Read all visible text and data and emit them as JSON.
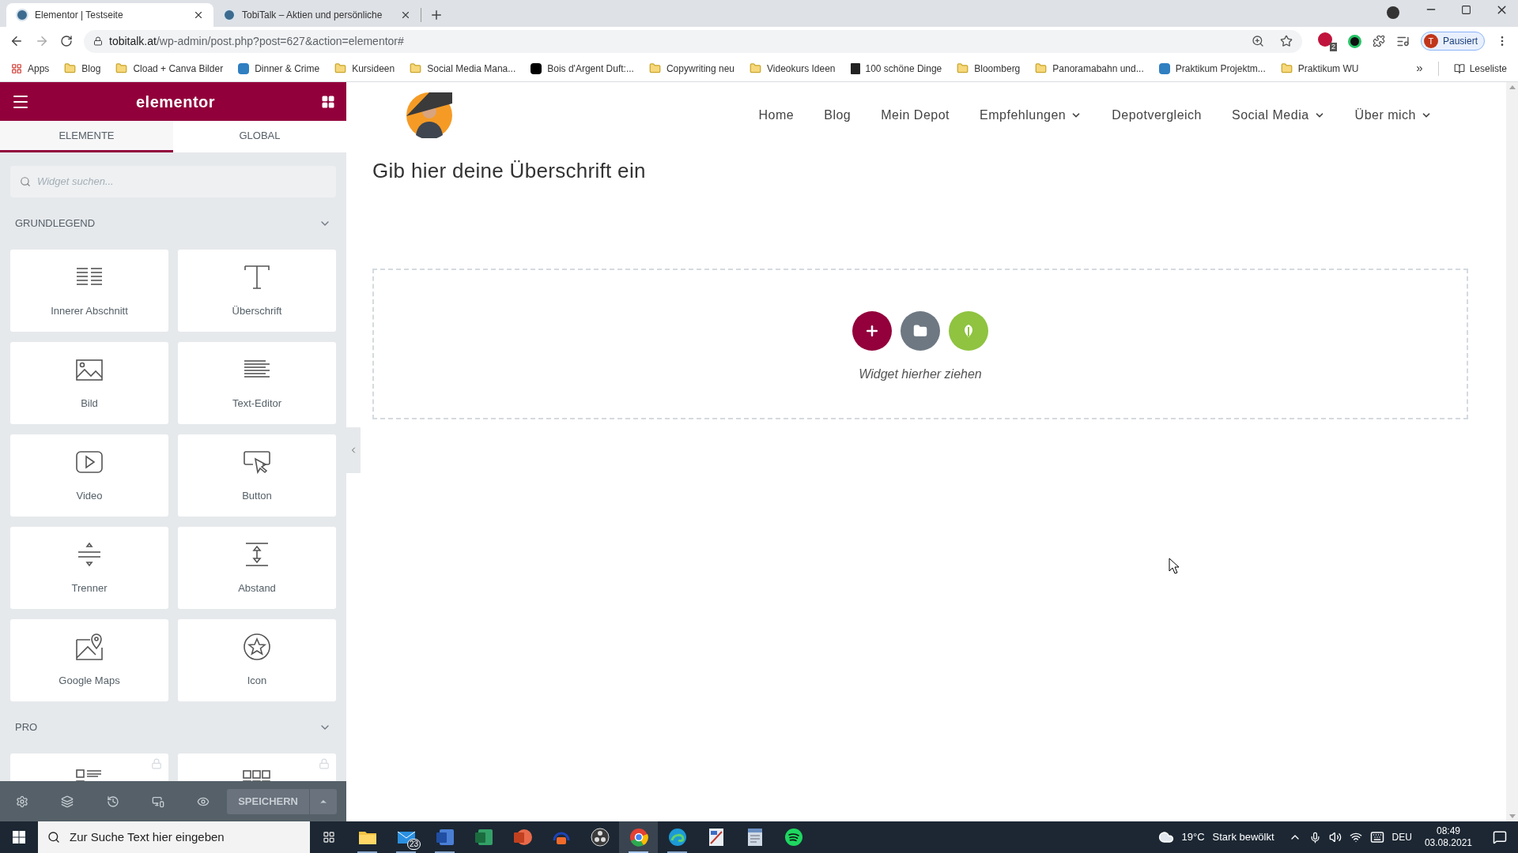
{
  "browser": {
    "tabs": [
      {
        "title": "Elementor | Testseite",
        "selected": true
      },
      {
        "title": "TobiTalk – Aktien und persönliche",
        "selected": false
      }
    ],
    "url_host": "tobitalk.at",
    "url_path": "/wp-admin/post.php?post=627&action=elementor#",
    "extension_badge": "2",
    "profile_initial": "T",
    "profile_label": "Pausiert",
    "bookmarks": [
      {
        "label": "Apps",
        "kind": "apps"
      },
      {
        "label": "Blog",
        "kind": "folder"
      },
      {
        "label": "Cload + Canva Bilder",
        "kind": "folder"
      },
      {
        "label": "Dinner & Crime",
        "kind": "site_blue"
      },
      {
        "label": "Kursideen",
        "kind": "folder"
      },
      {
        "label": "Social Media Mana...",
        "kind": "folder"
      },
      {
        "label": "Bois d'Argent Duft:...",
        "kind": "site_black"
      },
      {
        "label": "Copywriting neu",
        "kind": "folder"
      },
      {
        "label": "Videokurs Ideen",
        "kind": "folder"
      },
      {
        "label": "100 schöne Dinge",
        "kind": "site_letter"
      },
      {
        "label": "Bloomberg",
        "kind": "folder"
      },
      {
        "label": "Panoramabahn und...",
        "kind": "folder"
      },
      {
        "label": "Praktikum Projektm...",
        "kind": "site_blue"
      },
      {
        "label": "Praktikum WU",
        "kind": "folder"
      }
    ],
    "more_bookmarks": "»",
    "reading_list": "Leseliste"
  },
  "editor": {
    "logo": "elementor",
    "tabs": [
      {
        "label": "ELEMENTE",
        "selected": true
      },
      {
        "label": "GLOBAL",
        "selected": false
      }
    ],
    "search_placeholder": "Widget suchen...",
    "categories": [
      {
        "title": "GRUNDLEGEND",
        "expanded": true,
        "widgets": [
          {
            "label": "Innerer Abschnitt",
            "kind": "columns",
            "locked": false
          },
          {
            "label": "Überschrift",
            "kind": "heading",
            "locked": false
          },
          {
            "label": "Bild",
            "kind": "image",
            "locked": false
          },
          {
            "label": "Text-Editor",
            "kind": "text",
            "locked": false
          },
          {
            "label": "Video",
            "kind": "video",
            "locked": false
          },
          {
            "label": "Button",
            "kind": "button",
            "locked": false
          },
          {
            "label": "Trenner",
            "kind": "divider",
            "locked": false
          },
          {
            "label": "Abstand",
            "kind": "spacer",
            "locked": false
          },
          {
            "label": "Google Maps",
            "kind": "map",
            "locked": false
          },
          {
            "label": "Icon",
            "kind": "star",
            "locked": false
          }
        ]
      },
      {
        "title": "PRO",
        "expanded": true,
        "widgets": [
          {
            "kind": "posts",
            "locked": true
          },
          {
            "kind": "portfolio",
            "locked": true
          }
        ]
      }
    ],
    "save_button": "SPEICHERN"
  },
  "page": {
    "nav": [
      {
        "label": "Home",
        "dropdown": false
      },
      {
        "label": "Blog",
        "dropdown": false
      },
      {
        "label": "Mein Depot",
        "dropdown": false
      },
      {
        "label": "Empfehlungen",
        "dropdown": true
      },
      {
        "label": "Depotvergleich",
        "dropdown": false
      },
      {
        "label": "Social Media",
        "dropdown": true
      },
      {
        "label": "Über mich",
        "dropdown": true
      }
    ],
    "heading": "Gib hier deine Überschrift ein",
    "drop_zone_text": "Widget hierher ziehen"
  },
  "taskbar": {
    "search_placeholder": "Zur Suche Text hier eingeben",
    "apps": [
      {
        "kind": "folder",
        "running": true,
        "selected": false
      },
      {
        "kind": "mail",
        "running": true,
        "selected": false,
        "badge": "23"
      },
      {
        "kind": "doc",
        "running": true,
        "selected": false
      },
      {
        "kind": "sheet",
        "running": false,
        "selected": false
      },
      {
        "kind": "slides",
        "running": false,
        "selected": false
      },
      {
        "kind": "audio",
        "running": false,
        "selected": false
      },
      {
        "kind": "aperture",
        "running": false,
        "selected": false
      },
      {
        "kind": "browser",
        "running": true,
        "selected": true
      },
      {
        "kind": "edge",
        "running": true,
        "selected": false
      },
      {
        "kind": "tool",
        "running": false,
        "selected": false
      },
      {
        "kind": "notes",
        "running": false,
        "selected": false
      },
      {
        "kind": "music",
        "running": false,
        "selected": false
      }
    ],
    "temperature": "19°C",
    "weather": "Stark bewölkt",
    "language": "DEU",
    "time": "08:49",
    "date": "03.08.2021"
  }
}
